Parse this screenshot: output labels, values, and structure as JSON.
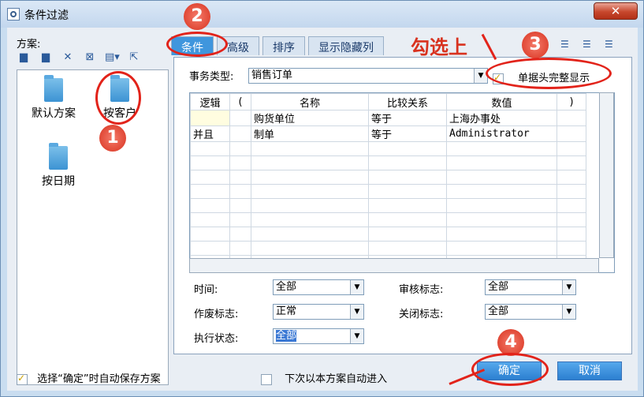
{
  "window": {
    "title": "条件过滤"
  },
  "scheme": {
    "label": "方案:",
    "items": [
      "默认方案",
      "按客户",
      "按日期"
    ]
  },
  "tabs": [
    "条件",
    "高级",
    "排序",
    "显示隐藏列"
  ],
  "business_type": {
    "label": "事务类型:",
    "value": "销售订单"
  },
  "header_full_display": {
    "label": "单据头完整显示",
    "checked": true
  },
  "grid": {
    "columns": [
      "逻辑",
      "(",
      "名称",
      "比较关系",
      "数值",
      ")"
    ],
    "rows": [
      [
        "",
        "",
        "购货单位",
        "等于",
        "上海办事处",
        ""
      ],
      [
        "并且",
        "",
        "制单",
        "等于",
        "Administrator",
        ""
      ]
    ]
  },
  "filters": {
    "time": {
      "label": "时间:",
      "value": "全部"
    },
    "audit": {
      "label": "审核标志:",
      "value": "全部"
    },
    "void": {
      "label": "作废标志:",
      "value": "正常"
    },
    "close": {
      "label": "关闭标志:",
      "value": "全部"
    },
    "exec": {
      "label": "执行状态:",
      "value": "全部"
    }
  },
  "footer": {
    "auto_save": {
      "label": "选择“确定”时自动保存方案",
      "checked": true
    },
    "auto_enter": {
      "label": "下次以本方案自动进入",
      "checked": false
    },
    "ok": "确定",
    "cancel": "取消"
  },
  "annotations": {
    "badges": [
      "1",
      "2",
      "3",
      "4"
    ],
    "note": "勾选上"
  },
  "colors": {
    "annotation_red": "#e2231a",
    "tab_active": "#3f96dd"
  }
}
